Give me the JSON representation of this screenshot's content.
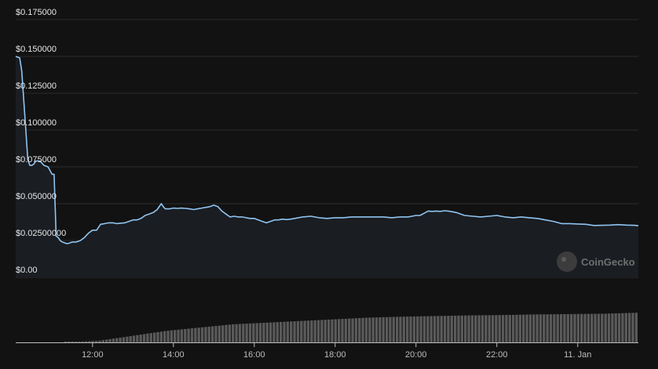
{
  "chart_data": {
    "type": "line",
    "watermark": "CoinGecko",
    "y_ticks": [
      "$0.00",
      "$0.02500000",
      "$0.050000",
      "$0.075000",
      "$0.100000",
      "$0.125000",
      "$0.150000",
      "$0.175000"
    ],
    "y_tick_values": [
      0,
      0.025,
      0.05,
      0.075,
      0.1,
      0.125,
      0.15,
      0.175
    ],
    "ylim": [
      0,
      0.175
    ],
    "x_ticks": [
      "12:00",
      "14:00",
      "16:00",
      "18:00",
      "20:00",
      "22:00",
      "11. Jan"
    ],
    "x_tick_values": [
      12,
      14,
      16,
      18,
      20,
      22,
      24
    ],
    "xlim": [
      10.1,
      25.5
    ],
    "grid": true,
    "colors": {
      "line": "#8fc4f0",
      "area": "#1a1d22",
      "volume": "#5a5a5a",
      "grid": "#2c2c2c",
      "background": "#121212"
    },
    "series": [
      {
        "values_x": [
          10.1,
          10.2,
          10.25,
          10.3,
          10.35,
          10.4,
          10.45,
          10.5,
          10.55,
          10.6,
          10.7,
          10.8,
          10.9,
          11.0,
          11.05,
          11.1,
          11.15,
          11.2,
          11.25,
          11.3,
          11.35,
          11.4,
          11.5,
          11.6,
          11.7,
          11.8,
          11.9,
          12.0,
          12.1,
          12.2,
          12.3,
          12.4,
          12.5,
          12.6,
          12.7,
          12.8,
          12.9,
          13.0,
          13.1,
          13.2,
          13.3,
          13.4,
          13.5,
          13.6,
          13.7,
          13.75,
          13.8,
          13.9,
          14.0,
          14.1,
          14.2,
          14.3,
          14.4,
          14.5,
          14.6,
          14.7,
          14.8,
          14.9,
          15.0,
          15.1,
          15.2,
          15.3,
          15.4,
          15.5,
          15.6,
          15.7,
          15.8,
          15.9,
          16.0,
          16.1,
          16.2,
          16.3,
          16.4,
          16.5,
          16.6,
          16.7,
          16.8,
          16.9,
          17.0,
          17.2,
          17.4,
          17.6,
          17.8,
          18.0,
          18.2,
          18.4,
          18.6,
          18.8,
          19.0,
          19.2,
          19.4,
          19.6,
          19.8,
          19.9,
          20.0,
          20.1,
          20.2,
          20.3,
          20.4,
          20.5,
          20.6,
          20.7,
          20.8,
          20.9,
          21.0,
          21.2,
          21.4,
          21.6,
          21.8,
          22.0,
          22.2,
          22.4,
          22.6,
          22.8,
          23.0,
          23.2,
          23.4,
          23.6,
          23.8,
          24.0,
          24.2,
          24.4,
          24.6,
          24.8,
          25.0,
          25.2,
          25.4,
          25.5
        ],
        "values": [
          0.15,
          0.149,
          0.14,
          0.12,
          0.1,
          0.08,
          0.076,
          0.076,
          0.077,
          0.079,
          0.079,
          0.076,
          0.075,
          0.07,
          0.07,
          0.028,
          0.027,
          0.025,
          0.024,
          0.0235,
          0.023,
          0.023,
          0.024,
          0.024,
          0.025,
          0.027,
          0.03,
          0.032,
          0.032,
          0.036,
          0.0365,
          0.037,
          0.037,
          0.0365,
          0.0368,
          0.037,
          0.038,
          0.039,
          0.039,
          0.04,
          0.042,
          0.043,
          0.044,
          0.046,
          0.05,
          0.048,
          0.0465,
          0.0465,
          0.047,
          0.0468,
          0.047,
          0.0468,
          0.0465,
          0.046,
          0.0465,
          0.047,
          0.0475,
          0.048,
          0.049,
          0.048,
          0.045,
          0.043,
          0.041,
          0.0415,
          0.041,
          0.041,
          0.0405,
          0.04,
          0.04,
          0.039,
          0.038,
          0.037,
          0.038,
          0.039,
          0.039,
          0.0395,
          0.0392,
          0.0395,
          0.04,
          0.041,
          0.0415,
          0.0405,
          0.04,
          0.0405,
          0.0405,
          0.041,
          0.041,
          0.041,
          0.041,
          0.041,
          0.0405,
          0.041,
          0.041,
          0.0415,
          0.042,
          0.042,
          0.0435,
          0.045,
          0.0448,
          0.045,
          0.0448,
          0.0452,
          0.045,
          0.0445,
          0.044,
          0.042,
          0.0415,
          0.041,
          0.0415,
          0.042,
          0.041,
          0.0405,
          0.041,
          0.0405,
          0.04,
          0.039,
          0.038,
          0.0365,
          0.0365,
          0.0362,
          0.036,
          0.0352,
          0.0353,
          0.0355,
          0.0358,
          0.0355,
          0.0353,
          0.035
        ]
      }
    ],
    "volume": {
      "start_x": 11.3,
      "end_x": 25.5,
      "count": 168,
      "levels": [
        0.0,
        0.05,
        0.2,
        0.35,
        0.45,
        0.55,
        0.6,
        0.65,
        0.7,
        0.75,
        0.78,
        0.8,
        0.82,
        0.83,
        0.85,
        0.86,
        0.87,
        0.9
      ]
    }
  }
}
